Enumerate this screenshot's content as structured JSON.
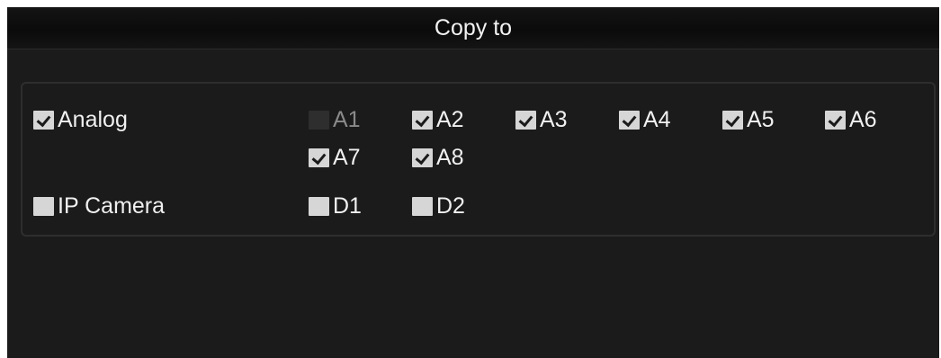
{
  "dialog": {
    "title": "Copy to"
  },
  "groups": [
    {
      "label": "Analog",
      "checked": true,
      "channels": [
        {
          "label": "A1",
          "checked": false,
          "disabled": true
        },
        {
          "label": "A2",
          "checked": true,
          "disabled": false
        },
        {
          "label": "A3",
          "checked": true,
          "disabled": false
        },
        {
          "label": "A4",
          "checked": true,
          "disabled": false
        },
        {
          "label": "A5",
          "checked": true,
          "disabled": false
        },
        {
          "label": "A6",
          "checked": true,
          "disabled": false
        },
        {
          "label": "A7",
          "checked": true,
          "disabled": false
        },
        {
          "label": "A8",
          "checked": true,
          "disabled": false
        }
      ]
    },
    {
      "label": "IP Camera",
      "checked": false,
      "channels": [
        {
          "label": "D1",
          "checked": false,
          "disabled": false
        },
        {
          "label": "D2",
          "checked": false,
          "disabled": false
        }
      ]
    }
  ]
}
